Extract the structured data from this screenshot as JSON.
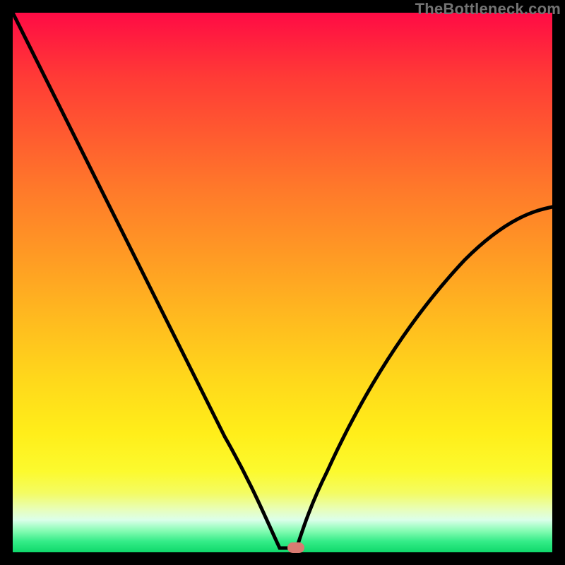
{
  "watermark": "TheBottleneck.com",
  "colors": {
    "background": "#000000",
    "marker": "#d97b72",
    "curve": "#000000"
  },
  "chart_data": {
    "type": "line",
    "title": "",
    "xlabel": "",
    "ylabel": "",
    "x": [
      0,
      2,
      6,
      10,
      15,
      20,
      25,
      30,
      35,
      40,
      45,
      48,
      50,
      52,
      53,
      55,
      57,
      60,
      65,
      70,
      75,
      80,
      85,
      90,
      95,
      100
    ],
    "values": [
      100,
      94,
      82,
      71,
      59,
      50,
      42,
      34,
      27,
      20,
      12,
      6,
      1,
      0,
      0,
      3,
      8,
      14,
      23,
      31,
      38,
      44,
      50,
      55,
      60,
      64
    ],
    "xlim": [
      0,
      100
    ],
    "ylim": [
      0,
      100
    ],
    "marker_point": {
      "x": 52.5,
      "y": 0
    },
    "legend": false,
    "grid": false
  }
}
